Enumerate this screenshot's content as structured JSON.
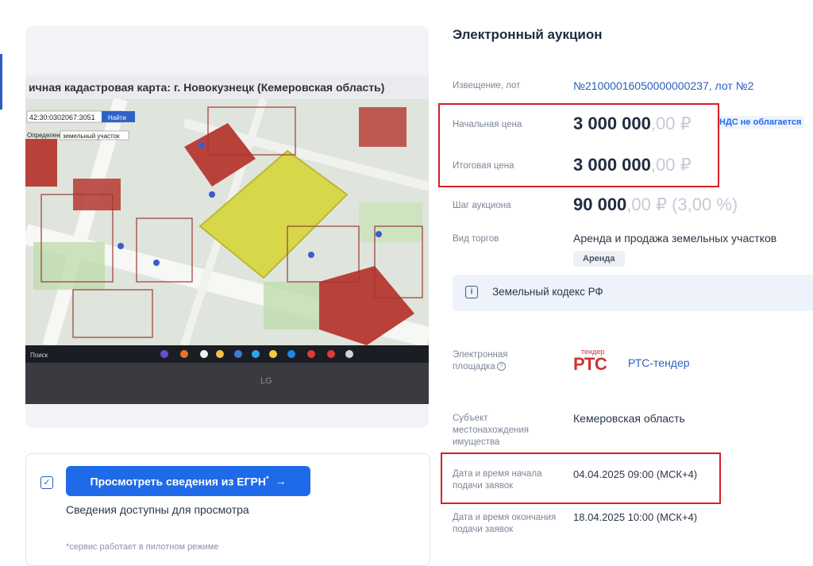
{
  "photo": {
    "map_title": "ичная кадастровая карта: г. Новокузнецк (Кемеровская область)",
    "search_value": "42:30:0302067:3051",
    "search_button": "Найти",
    "definition_label": "Определение:",
    "definition_select": "земельный участок",
    "taskbar_search": "Поиск",
    "monitor_brand": "LG"
  },
  "egrn": {
    "button_label": "Просмотреть сведения из ЕГРН",
    "button_sup": "*",
    "button_arrow": "→",
    "available": "Сведения доступны для просмотра",
    "note": "*сервис работает в пилотном режиме"
  },
  "auction": {
    "title": "Электронный аукцион",
    "notice_label": "Извещение, лот",
    "notice_value": "№21000016050000000237, лот №2",
    "start_price_label": "Начальная цена",
    "start_price": "3 000 000",
    "start_price_cents": ",00 ₽",
    "vat": "НДС не облагается",
    "final_price_label": "Итоговая цена",
    "final_price": "3 000 000",
    "final_price_cents": ",00 ₽",
    "step_label": "Шаг аукциона",
    "step_value": "90 000",
    "step_cents": ",00 ₽ (3,00 %)",
    "trade_type_label": "Вид торгов",
    "trade_type_value": "Аренда и продажа земельных участков",
    "trade_badge": "Аренда",
    "law": "Земельный кодекс РФ",
    "platform_label_1": "Электронная",
    "platform_label_2": "площадка",
    "platform_logo_small": "тендер",
    "platform_logo_big": "РТС",
    "platform_name": "РТС-тендер",
    "subject_label_1": "Субъект",
    "subject_label_2": "местонахождения",
    "subject_label_3": "имущества",
    "subject_value": "Кемеровская область",
    "start_date_label_1": "Дата и время начала",
    "start_date_label_2": "подачи заявок",
    "start_date_value": "04.04.2025 09:00 (МСК+4)",
    "end_date_label_1": "Дата и время окончания",
    "end_date_label_2": "подачи заявок",
    "end_date_value": "18.04.2025 10:00 (МСК+4)"
  },
  "colors": {
    "accent": "#1e6ae8",
    "highlight": "#d8202a",
    "parcel_red": "#b8413a",
    "parcel_yellow": "#d6d84a"
  }
}
